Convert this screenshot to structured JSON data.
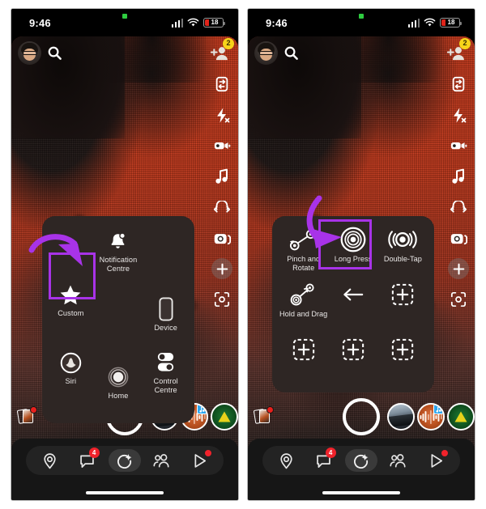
{
  "status_bar": {
    "time": "9:46",
    "battery_level": "18",
    "recording_indicator": "screen-recording-dot",
    "signal_icon": "cellular-signal-icon",
    "wifi_icon": "wifi-icon",
    "battery_icon": "battery-low-icon"
  },
  "colors": {
    "highlight": "#a833e8",
    "badge_yellow": "#f7d41a",
    "badge_red": "#f0222b",
    "battery_red": "#e0241a",
    "panel_bg": "#2e2624"
  },
  "camera_top_bar": {
    "avatar": "bitmoji-avatar",
    "search_icon": "search-icon",
    "add_friend_icon": "add-friend-icon",
    "add_friend_badge": "2",
    "flip_camera_icon": "flip-camera-icon"
  },
  "camera_rail": [
    {
      "name": "flip-camera-icon",
      "label": "Flip Camera"
    },
    {
      "name": "flash-off-icon",
      "label": "Flash Off"
    },
    {
      "name": "video-timer-icon",
      "label": "Timer"
    },
    {
      "name": "music-note-icon",
      "label": "Music"
    },
    {
      "name": "loop-arrows-icon",
      "label": "Loop"
    },
    {
      "name": "multi-snap-icon",
      "label": "Multi Snap"
    },
    {
      "name": "add-lens-icon",
      "label": "Add"
    },
    {
      "name": "scan-icon",
      "label": "Scan"
    }
  ],
  "carousel": {
    "memories_icon": "memories-cards-icon",
    "memories_has_badge": true,
    "shutter": "shutter-button",
    "thumbnails": [
      {
        "name": "story-thumbnail-dashcam",
        "badge": null
      },
      {
        "name": "story-thumbnail-audio",
        "badge": "music-note-badge"
      },
      {
        "name": "story-thumbnail-green",
        "badge": null
      }
    ]
  },
  "bottom_nav": [
    {
      "name": "nav-map",
      "icon": "map-pin-icon",
      "badge": null,
      "dot": false,
      "active": false
    },
    {
      "name": "nav-chat",
      "icon": "chat-bubble-icon",
      "badge": "4",
      "dot": false,
      "active": false
    },
    {
      "name": "nav-camera",
      "icon": "camera-sparkle-icon",
      "badge": null,
      "dot": false,
      "active": true
    },
    {
      "name": "nav-friends",
      "icon": "friends-icon",
      "badge": null,
      "dot": false,
      "active": false
    },
    {
      "name": "nav-spotlight",
      "icon": "play-triangle-icon",
      "badge": null,
      "dot": true,
      "active": false
    }
  ],
  "left_phone": {
    "panel_name": "assistive-touch-menu",
    "items": [
      {
        "label": "",
        "icon": "blank-slot",
        "blank": true
      },
      {
        "label": "Notification Centre",
        "icon": "bell-icon",
        "blank": false
      },
      {
        "label": "",
        "icon": "blank-slot",
        "blank": true
      },
      {
        "label": "Custom",
        "icon": "star-icon",
        "blank": false,
        "highlighted": true
      },
      {
        "label": "",
        "icon": "blank-slot",
        "blank": true
      },
      {
        "label": "Device",
        "icon": "device-phone-icon",
        "blank": false
      },
      {
        "label": "Siri",
        "icon": "siri-icon",
        "blank": false
      },
      {
        "label": "Home",
        "icon": "home-rings-icon",
        "blank": false
      },
      {
        "label": "Control Centre",
        "icon": "control-centre-toggles-icon",
        "blank": false
      }
    ],
    "annotation": {
      "arrow": "purple-curved-arrow",
      "points_to": "Custom"
    }
  },
  "right_phone": {
    "panel_name": "assistive-touch-gestures-menu",
    "items": [
      {
        "label": "Pinch and Rotate",
        "icon": "pinch-rotate-icon",
        "placeholder": false
      },
      {
        "label": "Long Press",
        "icon": "long-press-bullseye-icon",
        "placeholder": false,
        "highlighted": true
      },
      {
        "label": "Double-Tap",
        "icon": "double-tap-icon",
        "placeholder": false
      },
      {
        "label": "Hold and Drag",
        "icon": "hold-drag-icon",
        "placeholder": false
      },
      {
        "label": "",
        "icon": "back-arrow-icon",
        "placeholder": false,
        "is_back": true
      },
      {
        "label": "",
        "icon": "add-placeholder-icon",
        "placeholder": true
      },
      {
        "label": "",
        "icon": "add-placeholder-icon",
        "placeholder": true
      },
      {
        "label": "",
        "icon": "add-placeholder-icon",
        "placeholder": true
      },
      {
        "label": "",
        "icon": "add-placeholder-icon",
        "placeholder": true
      }
    ],
    "annotation": {
      "arrow": "purple-curved-arrow",
      "points_to": "Long Press"
    }
  }
}
